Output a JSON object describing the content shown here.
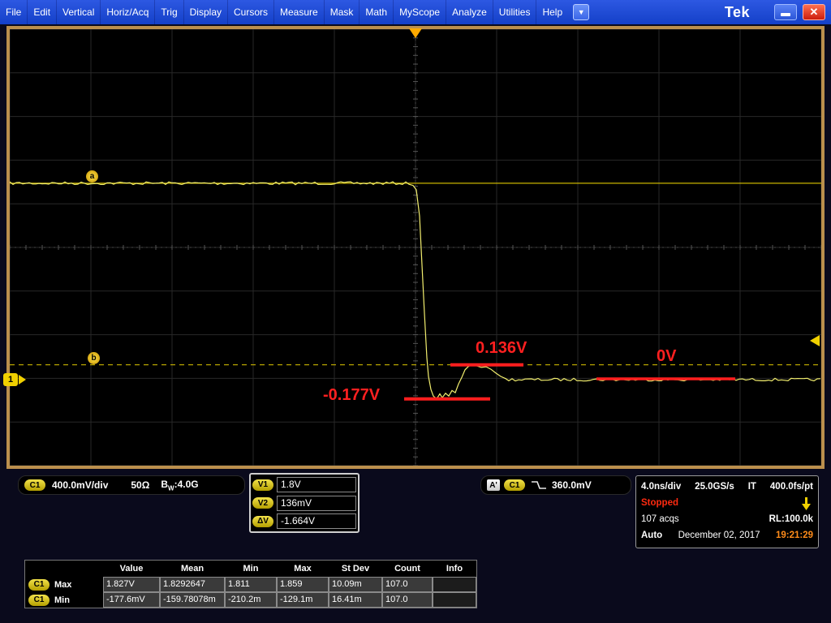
{
  "menu": {
    "items": [
      "File",
      "Edit",
      "Vertical",
      "Horiz/Acq",
      "Trig",
      "Display",
      "Cursors",
      "Measure",
      "Mask",
      "Math",
      "MyScope",
      "Analyze",
      "Utilities",
      "Help"
    ],
    "logo": "Tek"
  },
  "icons": {
    "close": "✕",
    "dropdown_arrow": "▼"
  },
  "channel": {
    "badge": "C1",
    "scale": "400.0mV/div",
    "termination": "50Ω",
    "bw_prefix": "B",
    "bw_sub": "W",
    "bw_suffix": ":4.0G"
  },
  "cursors": {
    "rows": [
      {
        "label": "V1",
        "value": "1.8V"
      },
      {
        "label": "V2",
        "value": "136mV"
      },
      {
        "label": "ΔV",
        "value": "-1.664V"
      }
    ],
    "marker_a": "a",
    "marker_b": "b"
  },
  "trigger": {
    "source": "A'",
    "channel": "C1",
    "level": "360.0mV"
  },
  "horizontal": {
    "timebase": "4.0ns/div",
    "sample_rate": "25.0GS/s",
    "sampling_mode": "IT",
    "resolution": "400.0fs/pt",
    "status": "Stopped",
    "acquisitions": "107 acqs",
    "record_length": "RL:100.0k",
    "trigger_mode": "Auto",
    "date": "December 02, 2017",
    "time": "19:21:29"
  },
  "annotations": {
    "overshoot": "0.136V",
    "undershoot": "-0.177V",
    "settle": "0V"
  },
  "markers": {
    "ground": "1"
  },
  "measurements": {
    "headers": [
      "Value",
      "Mean",
      "Min",
      "Max",
      "St Dev",
      "Count",
      "Info"
    ],
    "rows": [
      {
        "badge": "C1",
        "name": "Max",
        "values": [
          "1.827V",
          "1.8292647",
          "1.811",
          "1.859",
          "10.09m",
          "107.0",
          ""
        ]
      },
      {
        "badge": "C1",
        "name": "Min",
        "values": [
          "-177.6mV",
          "-159.78078m",
          "-210.2m",
          "-129.1m",
          "16.41m",
          "107.0",
          ""
        ]
      }
    ]
  },
  "waveform": {
    "volts_per_div": 0.4,
    "high_v": 1.8,
    "cursor_a_v": 1.8,
    "cursor_b_v": 0.136,
    "overshoot_v": 0.136,
    "undershoot_v": -0.177,
    "settle_v": 0,
    "trigger_level_v": 0.36
  },
  "colors": {
    "trace": "#f2ee6e",
    "cursor": "#c9b400",
    "annotation_red": "#ff1e1e",
    "badge_yellow": "#e8d400",
    "time_orange": "#ff8c1a",
    "status_red": "#ff2a10"
  }
}
